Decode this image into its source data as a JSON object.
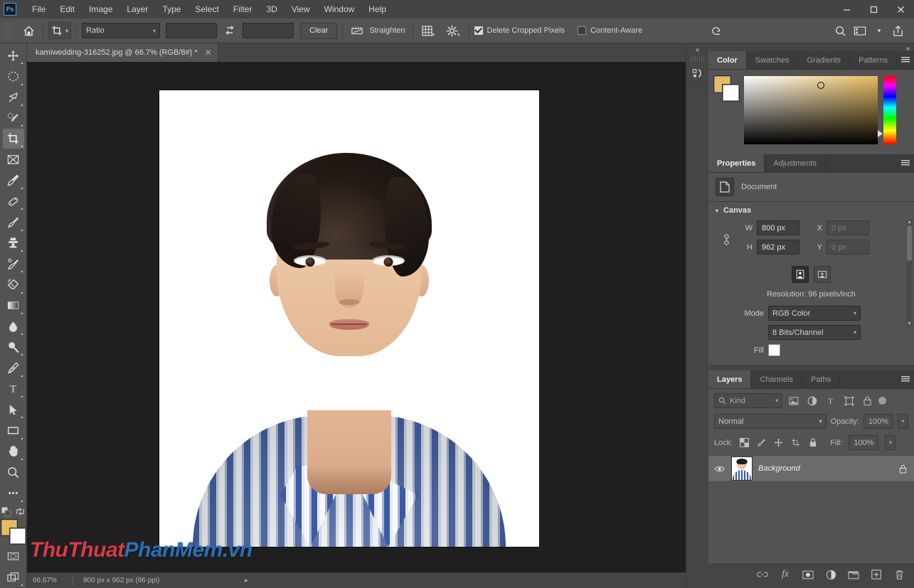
{
  "app": {
    "logo": "Ps",
    "menus": [
      "File",
      "Edit",
      "Image",
      "Layer",
      "Type",
      "Select",
      "Filter",
      "3D",
      "View",
      "Window",
      "Help"
    ],
    "window_controls": {
      "minimize": "—",
      "maximize": "□",
      "close": "✕"
    }
  },
  "options_bar": {
    "home_icon": "home-icon",
    "tool_icon": "crop-tool-icon",
    "ratio_label": "Ratio",
    "width_value": "",
    "width_placeholder": "",
    "swap_icon": "swap-arrows-icon",
    "height_value": "",
    "height_placeholder": "",
    "clear_label": "Clear",
    "straighten_label": "Straighten",
    "straighten_icon": "straighten-icon",
    "overlay_icon": "grid-overlay-icon",
    "settings_icon": "gear-icon",
    "delete_cropped_label": "Delete Cropped Pixels",
    "delete_cropped_checked": true,
    "content_aware_label": "Content-Aware",
    "content_aware_checked": false,
    "reset_icon": "reset-arrow-icon",
    "search_icon": "search-icon",
    "workspace_icon": "workspace-layout-icon",
    "chevron_icon": "chevron-down-icon",
    "share_icon": "share-icon"
  },
  "document_tab": {
    "title": "kamiwedding-316252.jpg @ 66.7% (RGB/8#) *",
    "close": "✕"
  },
  "toolbar": {
    "tools": [
      {
        "name": "move-tool",
        "icon": "move-icon",
        "active": false,
        "has_flyout": true
      },
      {
        "name": "marquee-tool",
        "icon": "elliptical-marquee-icon",
        "active": false,
        "has_flyout": true
      },
      {
        "name": "lasso-tool",
        "icon": "lasso-icon",
        "active": false,
        "has_flyout": true
      },
      {
        "name": "quick-selection-tool",
        "icon": "quick-selection-icon",
        "active": false,
        "has_flyout": true
      },
      {
        "name": "crop-tool",
        "icon": "crop-icon",
        "active": true,
        "has_flyout": true
      },
      {
        "name": "frame-tool",
        "icon": "frame-icon",
        "active": false,
        "has_flyout": false
      },
      {
        "name": "eyedropper-tool",
        "icon": "eyedropper-icon",
        "active": false,
        "has_flyout": true
      },
      {
        "name": "healing-brush-tool",
        "icon": "healing-brush-icon",
        "active": false,
        "has_flyout": true
      },
      {
        "name": "brush-tool",
        "icon": "brush-icon",
        "active": false,
        "has_flyout": true
      },
      {
        "name": "clone-stamp-tool",
        "icon": "clone-stamp-icon",
        "active": false,
        "has_flyout": true
      },
      {
        "name": "history-brush-tool",
        "icon": "history-brush-icon",
        "active": false,
        "has_flyout": true
      },
      {
        "name": "eraser-tool",
        "icon": "eraser-icon",
        "active": false,
        "has_flyout": true
      },
      {
        "name": "gradient-tool",
        "icon": "gradient-icon",
        "active": false,
        "has_flyout": true
      },
      {
        "name": "blur-tool",
        "icon": "blur-droplet-icon",
        "active": false,
        "has_flyout": true
      },
      {
        "name": "dodge-tool",
        "icon": "dodge-icon",
        "active": false,
        "has_flyout": true
      },
      {
        "name": "pen-tool",
        "icon": "pen-icon",
        "active": false,
        "has_flyout": true
      },
      {
        "name": "type-tool",
        "icon": "type-T-icon",
        "active": false,
        "has_flyout": true
      },
      {
        "name": "path-selection-tool",
        "icon": "path-arrow-icon",
        "active": false,
        "has_flyout": true
      },
      {
        "name": "rectangle-tool",
        "icon": "rectangle-icon",
        "active": false,
        "has_flyout": true
      },
      {
        "name": "hand-tool",
        "icon": "hand-icon",
        "active": false,
        "has_flyout": true
      },
      {
        "name": "zoom-tool",
        "icon": "magnifier-icon",
        "active": false,
        "has_flyout": false
      },
      {
        "name": "edit-toolbar",
        "icon": "ellipsis-icon",
        "active": false,
        "has_flyout": true
      }
    ],
    "default_colors_icon": "default-colors-icon",
    "swap_colors_icon": "swap-colors-icon",
    "foreground_color": "#e8bc5e",
    "background_color": "#ffffff",
    "quick_mask_icon": "quick-mask-icon",
    "screen_mode_icon": "screen-mode-icon"
  },
  "color_panel": {
    "tabs": [
      "Color",
      "Swatches",
      "Gradients",
      "Patterns"
    ],
    "active_tab": "Color",
    "foreground_color": "#e8bc5e",
    "background_color": "#ffffff",
    "menu_icon": "panel-menu-icon"
  },
  "properties_panel": {
    "tabs": [
      "Properties",
      "Adjustments"
    ],
    "active_tab": "Properties",
    "doc_label": "Document",
    "doc_icon": "document-icon",
    "section_title": "Canvas",
    "link_icon": "link-dimensions-icon",
    "w_label": "W",
    "w_value": "800 px",
    "h_label": "H",
    "h_value": "962 px",
    "x_label": "X",
    "x_value": "0 px",
    "y_label": "Y",
    "y_value": "0 px",
    "orientation_portrait_icon": "portrait-orientation-icon",
    "orientation_landscape_icon": "landscape-orientation-icon",
    "resolution_text": "Resolution: 96 pixels/inch",
    "mode_label": "Mode",
    "mode_value": "RGB Color",
    "depth_value": "8 Bits/Channel",
    "fill_label": "Fill",
    "fill_color": "#ffffff",
    "menu_icon": "panel-menu-icon"
  },
  "layers_panel": {
    "tabs": [
      "Layers",
      "Channels",
      "Paths"
    ],
    "active_tab": "Layers",
    "kind_label": "Kind",
    "search_icon": "search-icon",
    "filter_icons": [
      "pixel-filter-icon",
      "adjustment-filter-icon",
      "type-filter-icon",
      "shape-filter-icon",
      "smart-object-filter-icon"
    ],
    "filter_toggle_icon": "filter-toggle-icon",
    "blend_mode": "Normal",
    "opacity_label": "Opacity:",
    "opacity_value": "100%",
    "lock_label": "Lock:",
    "lock_icons": [
      "lock-transparency-icon",
      "lock-image-icon",
      "lock-position-icon",
      "lock-artboard-icon",
      "lock-all-icon"
    ],
    "fill_label": "Fill:",
    "fill_value": "100%",
    "layers": [
      {
        "name": "Background",
        "visible": true,
        "locked": true,
        "eye_icon": "eye-icon",
        "lock_icon": "lock-icon",
        "thumbnail": "portrait-thumbnail"
      }
    ],
    "footer_icons": [
      "link-layers-icon",
      "layer-style-fx-icon",
      "add-mask-icon",
      "new-adjustment-icon",
      "new-group-icon",
      "new-layer-icon",
      "delete-layer-icon"
    ],
    "footer_fx_label": "fx",
    "menu_icon": "panel-menu-icon"
  },
  "mini_dock": {
    "collapse_icon": "collapse-panels-icon",
    "items": [
      "history-actions-icon"
    ]
  },
  "status_bar": {
    "zoom": "66.67%",
    "doc_size": "800 px x 962 px (96 ppi)",
    "arrow_icon": "status-chevron-icon"
  },
  "canvas": {
    "zoom_percent": "66.67%",
    "image_description": "passport-portrait-photo"
  },
  "watermark": {
    "part1": "ThuThuat",
    "part2": "PhanMem",
    "part3": ".vn",
    "color1": "#d93a4a",
    "color2": "#2b6fb5"
  }
}
